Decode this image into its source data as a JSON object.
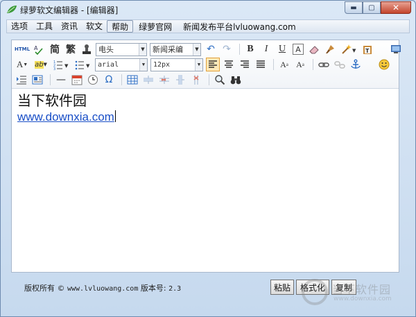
{
  "window": {
    "title": "绿萝软文编辑器 - [编辑器]",
    "controls": {
      "minimize": "▬",
      "maximize": "▢",
      "close": "✕"
    }
  },
  "menubar": {
    "items": [
      "选项",
      "工具",
      "资讯",
      "软文",
      "帮助"
    ],
    "active": "帮助",
    "links": [
      "绿萝官网",
      "新闻发布平台lvluowang.com"
    ]
  },
  "toolbar": {
    "row1": {
      "html_label": "HTML",
      "simplified": "简",
      "traditional": "繁",
      "combo_heading": "电头",
      "combo_source": "新闻采编",
      "bold": "B",
      "italic": "I",
      "underline": "U",
      "font_box": "A"
    },
    "row2": {
      "font_color": "A",
      "highlight": "ab",
      "combo_font": "arial",
      "combo_size": "12px",
      "superscript": "A",
      "subscript": "A"
    },
    "row3": {
      "horizontal_rule": "—",
      "omega": "Ω"
    }
  },
  "editor": {
    "text_line": "当下软件园",
    "link_text": "www.downxia.com"
  },
  "status": {
    "copyright_label": "版权所有 ©",
    "site": "www.lvluowang.com",
    "version_label": "版本号:",
    "version": "2.3"
  },
  "actions": {
    "paste": "粘贴",
    "format": "格式化",
    "copy": "复制"
  },
  "watermark": {
    "name": "当下软件园",
    "url": "www.downxia.com"
  },
  "colors": {
    "link": "#1a4fc7",
    "selected_tool": "#fde8b8",
    "close": "#c3452c"
  }
}
